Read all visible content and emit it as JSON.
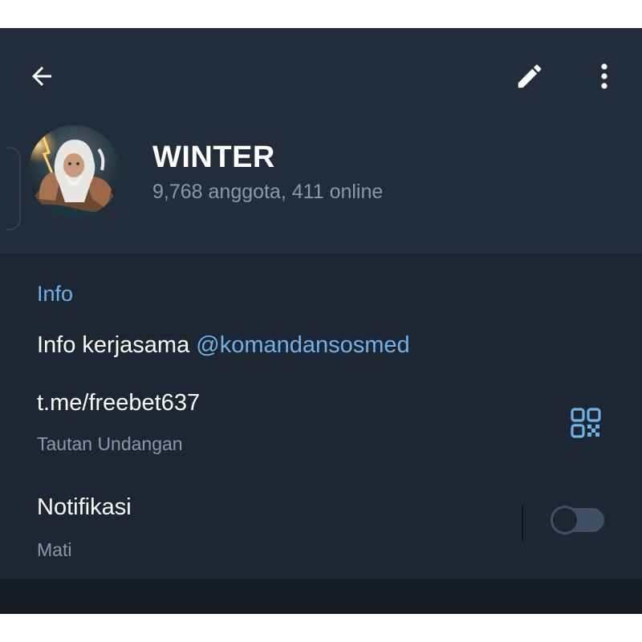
{
  "header": {
    "back_icon": "arrow-left-icon",
    "edit_icon": "pencil-icon",
    "more_icon": "vertical-dots-icon"
  },
  "group": {
    "name": "WINTER",
    "members_status": "9,768 anggota, 411 online",
    "avatar": "zeus-illustration"
  },
  "info": {
    "section_title": "Info",
    "description_text": "Info kerjasama ",
    "description_mention": "@komandansosmed",
    "invite_link": "t.me/freebet637",
    "invite_link_caption": "Tautan Undangan",
    "qr_icon": "qr-code-icon"
  },
  "notifications": {
    "title": "Notifikasi",
    "status": "Mati",
    "enabled": false
  },
  "colors": {
    "background": "#1d2733",
    "header_background": "#212d3b",
    "accent": "#6fb2ea",
    "secondary_text": "#8a99a8"
  }
}
